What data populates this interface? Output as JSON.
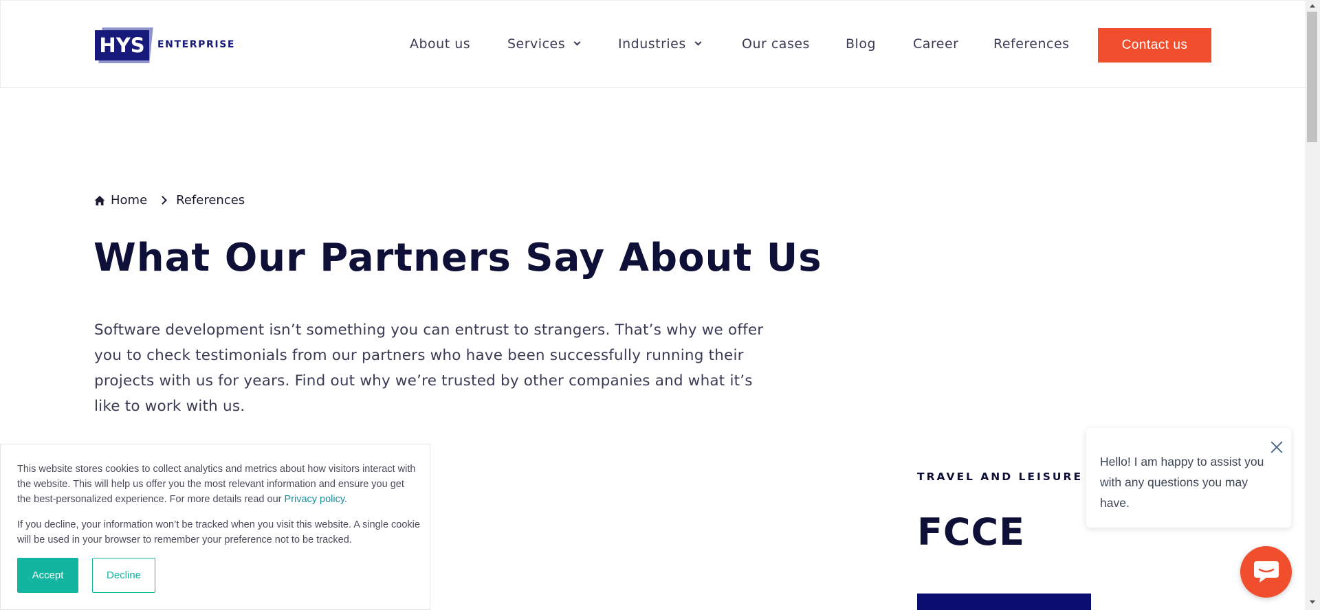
{
  "header": {
    "logo_mark": "HYS",
    "logo_text": "ENTERPRISE",
    "nav": [
      {
        "label": "About us"
      },
      {
        "label": "Services"
      },
      {
        "label": "Industries"
      },
      {
        "label": "Our cases"
      },
      {
        "label": "Blog"
      },
      {
        "label": "Career"
      },
      {
        "label": "References"
      }
    ],
    "contact_label": "Contact us"
  },
  "breadcrumb": {
    "home": "Home",
    "current": "References"
  },
  "main": {
    "title": "What Our Partners Say About Us",
    "intro": "Software development isn’t something you can entrust to strangers. That’s why we offer you to check testimonials from our partners who have been successfully running their projects with us for years. Find out why we’re trusted by other companies and what it’s like to work with us."
  },
  "case": {
    "category": "TRAVEL AND LEISURE",
    "title": "FCCE"
  },
  "cookie": {
    "text1": "This website stores cookies to collect analytics and metrics about how visitors interact with the website. This will help us offer you the most relevant information and ensure you get the best-personalized experience. For more details read our ",
    "privacy_link": "Privacy policy.",
    "text2": "If you decline, your information won’t be tracked when you visit this website. A single cookie will be used in your browser to remember your preference not to be tracked.",
    "accept": "Accept",
    "decline": "Decline"
  },
  "chat": {
    "message": "Hello! I am happy to assist you with any questions you may have."
  },
  "colors": {
    "brand_navy": "#171a7a",
    "accent_orange": "#f04e2d",
    "teal": "#12b6a0",
    "heading": "#0f1037"
  }
}
